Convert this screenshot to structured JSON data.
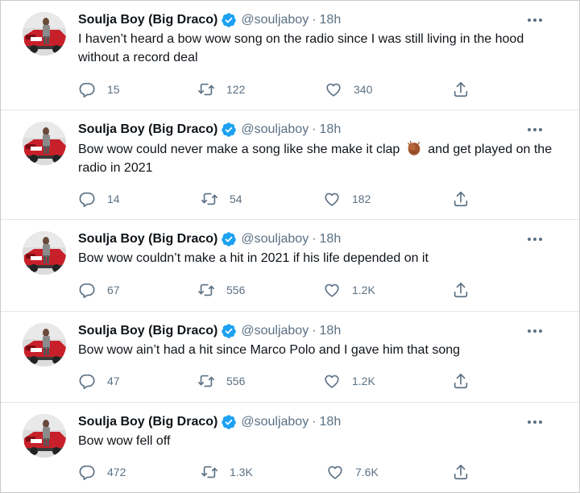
{
  "tweets": [
    {
      "author": "Soulja Boy (Big Draco)",
      "handle": "@souljaboy",
      "separator": "·",
      "time": "18h",
      "text": "I haven’t heard a bow wow song on the radio since I was still living in the hood without a record deal",
      "replies": "15",
      "retweets": "122",
      "likes": "340"
    },
    {
      "author": "Soulja Boy (Big Draco)",
      "handle": "@souljaboy",
      "separator": "·",
      "time": "18h",
      "text_before": "Bow wow could never make a song like she make it clap ",
      "text_after": " and get played on the radio in 2021",
      "emoji": "clapping-hands-emoji",
      "replies": "14",
      "retweets": "54",
      "likes": "182"
    },
    {
      "author": "Soulja Boy (Big Draco)",
      "handle": "@souljaboy",
      "separator": "·",
      "time": "18h",
      "text": "Bow wow couldn’t make a hit in 2021 if his life depended on it",
      "replies": "67",
      "retweets": "556",
      "likes": "1.2K"
    },
    {
      "author": "Soulja Boy (Big Draco)",
      "handle": "@souljaboy",
      "separator": "·",
      "time": "18h",
      "text": "Bow wow ain’t had a hit since Marco Polo and I gave him that song",
      "replies": "47",
      "retweets": "556",
      "likes": "1.2K"
    },
    {
      "author": "Soulja Boy (Big Draco)",
      "handle": "@souljaboy",
      "separator": "·",
      "time": "18h",
      "text": "Bow wow fell off",
      "replies": "472",
      "retweets": "1.3K",
      "likes": "7.6K"
    }
  ],
  "colors": {
    "text": "#0f1419",
    "secondary": "#5b7083",
    "verified": "#1da1f2",
    "divider": "#e3e7ea"
  },
  "icons": {
    "verified": "verified-badge-icon",
    "more": "more-options-icon",
    "reply": "reply-icon",
    "retweet": "retweet-icon",
    "like": "heart-icon",
    "share": "share-icon"
  }
}
